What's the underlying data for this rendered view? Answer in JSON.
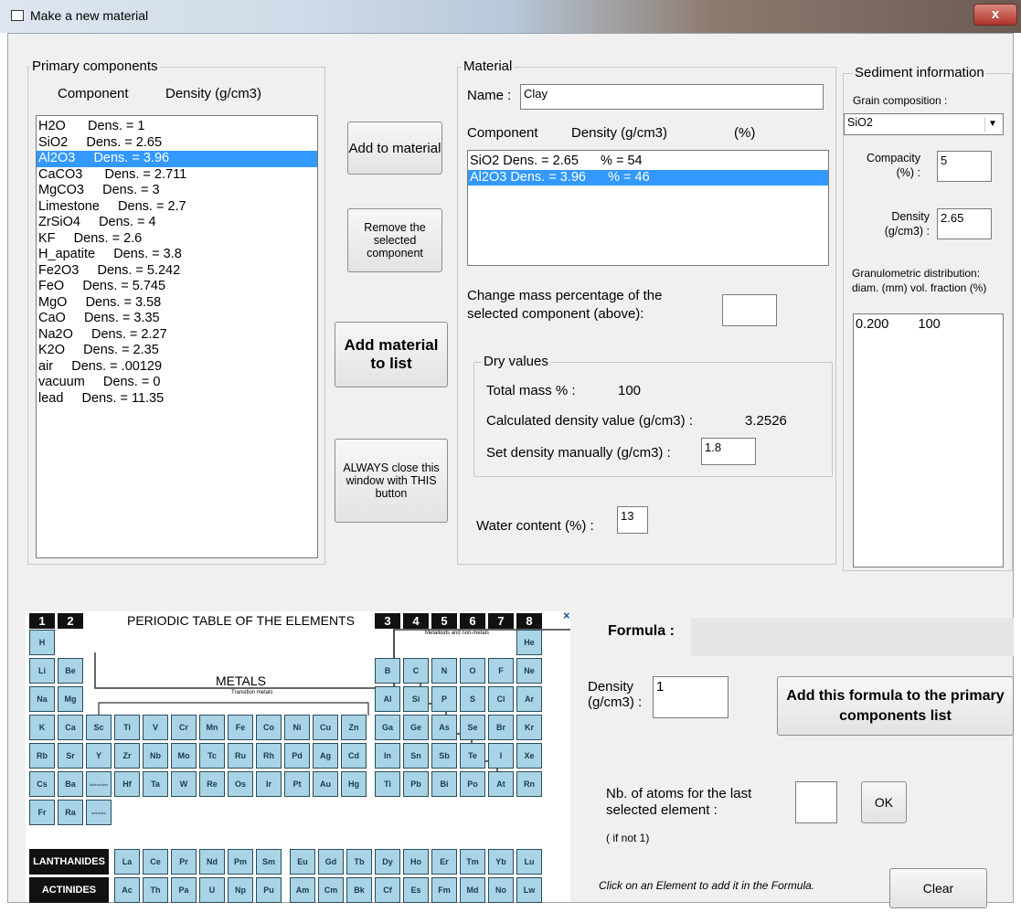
{
  "window": {
    "title": "Make a new material",
    "close_label": "x"
  },
  "primary": {
    "legend": "Primary components",
    "header_component": "Component",
    "header_density": "Density (g/cm3)",
    "items": [
      "H2O      Dens. = 1",
      "SiO2     Dens. = 2.65",
      "Al2O3     Dens. = 3.96",
      "CaCO3      Dens. = 2.711",
      "MgCO3     Dens. = 3",
      "Limestone     Dens. = 2.7",
      "ZrSiO4     Dens. = 4",
      "KF     Dens. = 2.6",
      "H_apatite     Dens. = 3.8",
      "Fe2O3     Dens. = 5.242",
      "FeO     Dens. = 5.745",
      "MgO     Dens. = 3.58",
      "CaO     Dens. = 3.35",
      "Na2O     Dens. = 2.27",
      "K2O     Dens. = 2.35",
      "air     Dens. = .00129",
      "vacuum     Dens. = 0",
      "lead     Dens. = 11.35"
    ],
    "selected_index": 2
  },
  "buttons": {
    "add_to_material": "Add to material",
    "remove_selected": "Remove the selected component",
    "add_material_to_list": "Add material to list",
    "always_close": "ALWAYS close this window with THIS button"
  },
  "material": {
    "legend": "Material",
    "name_label": "Name :",
    "name_value": "Clay",
    "header_component": "Component",
    "header_density": "Density (g/cm3)",
    "header_percent": "(%)",
    "items": [
      "SiO2 Dens. = 2.65      % = 54",
      "Al2O3 Dens. = 3.96      % = 46"
    ],
    "selected_index": 1,
    "change_mass_label": "Change mass percentage of the selected component (above):",
    "change_mass_value": "",
    "dry_legend": "Dry values",
    "total_mass_label": "Total mass  % :",
    "total_mass_value": "100",
    "calc_density_label": "Calculated  density value (g/cm3) :",
    "calc_density_value": "3.2526",
    "set_density_label": "Set density manually  (g/cm3) :",
    "set_density_value": "1.8",
    "water_label": "Water content (%) :",
    "water_value": "13"
  },
  "sediment": {
    "legend": "Sediment information",
    "grain_label": "Grain composition :",
    "grain_value": "SiO2",
    "compacity_label": "Compacity (%) :",
    "compacity_value": "5",
    "density_label": "Density (g/cm3) :",
    "density_value": "2.65",
    "granulo_label": "Granulometric distribution:",
    "granulo_header": "diam. (mm)   vol. fraction (%)",
    "granulo_items": [
      "0.200        100"
    ]
  },
  "periodic": {
    "title": "PERIODIC TABLE OF THE ELEMENTS",
    "metals_label": "METALS",
    "transition_label": "Transition metals",
    "metalloids_label": "Metalloids and non-metals",
    "group_numbers": [
      "1",
      "2",
      "3",
      "4",
      "5",
      "6",
      "7",
      "8"
    ],
    "close_mark": "×",
    "lanthanides_label": "LANTHANIDES",
    "actinides_label": "ACTINIDES",
    "lanthanide_ref": "lanthanides",
    "actinide_ref": "actinides"
  },
  "formula": {
    "label": "Formula :",
    "value": "",
    "density_label": "Density (g/cm3) :",
    "density_value": "1",
    "add_button": "Add this formula  to the primary components list",
    "atoms_label": "Nb. of atoms for the last selected element :",
    "atoms_value": "",
    "ok_label": "OK",
    "if_not_label": "( if not 1)",
    "hint": "Click on an Element to add it in the Formula.",
    "clear_label": "Clear"
  },
  "colors": {
    "selection": "#3399ff",
    "cell_fill": "#a8d4e6"
  }
}
